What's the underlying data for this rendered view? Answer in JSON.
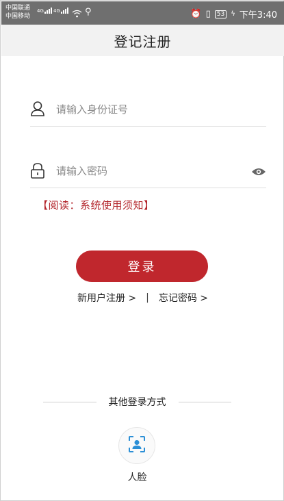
{
  "status_bar": {
    "carrier_1": "中国联通",
    "carrier_2": "中国移动",
    "sim1_type": "4G",
    "sim2_type": "4G",
    "battery": "53",
    "time": "下午3:40"
  },
  "header": {
    "title": "登记注册"
  },
  "form": {
    "id_placeholder": "请输入身份证号",
    "password_placeholder": "请输入密码"
  },
  "notice": "【阅读：系统使用须知】",
  "login_button": "登录",
  "links": {
    "register": "新用户注册 >",
    "separator": "|",
    "forgot": "忘记密码 >"
  },
  "other_login": {
    "title": "其他登录方式",
    "face_label": "人脸"
  },
  "colors": {
    "accent": "#c0272d",
    "status_bar": "#6f6f6f",
    "title_bar": "#f2f2f2"
  },
  "icons": [
    "user-icon",
    "lock-icon",
    "eye-icon",
    "face-scan-icon"
  ]
}
